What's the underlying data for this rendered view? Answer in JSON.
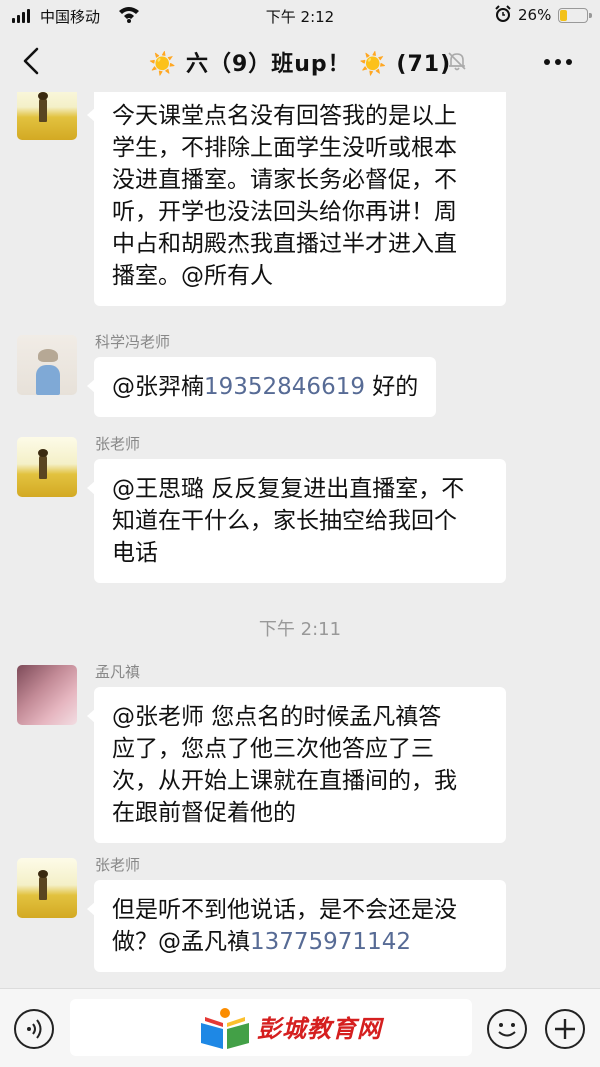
{
  "status_bar": {
    "carrier": "中国移动",
    "time": "下午 2:12",
    "battery": "26%",
    "battery_level": 0.26
  },
  "nav": {
    "title": "六（9）班up！",
    "member_count": "(71)",
    "title_emoji": "☀️"
  },
  "messages": [
    {
      "sender": "",
      "avatar": "field-avatar",
      "text": "今天课堂点名没有回答我的是以上学生，不排除上面学生没听或根本没进直播室。请家长务必督促，不听，开学也没法回头给你再讲！周中占和胡殿杰我直播过半才进入直播室。@所有人",
      "lines": [
        "今天课堂点名没有回答我的是以上",
        "学生，不排除上面学生没听或根本",
        "没进直播室。请家长务必督促，不",
        "听，开学也没法回头给你再讲！周",
        "中占和胡殿杰我直播过半才进入直",
        "播室。@所有人"
      ]
    },
    {
      "sender": "科学冯老师",
      "avatar": "girl-avatar",
      "prefix": "@张羿楠",
      "phone": "19352846619",
      "suffix": " 好的"
    },
    {
      "sender": "张老师",
      "avatar": "field-avatar",
      "lines": [
        "@王思璐 反反复复进出直播室，不",
        "知道在干什么，家长抽空给我回个",
        "电话"
      ]
    },
    {
      "time_divider": "下午 2:11"
    },
    {
      "sender": "孟凡禛",
      "avatar": "pink-avatar",
      "lines": [
        "@张老师 您点名的时候孟凡禛答",
        "应了，您点了他三次他答应了三",
        "次，从开始上课就在直播间的，我",
        "在跟前督促着他的"
      ]
    },
    {
      "sender": "张老师",
      "avatar": "field-avatar",
      "line1": "但是听不到他说话，是不会还是没",
      "line2_prefix": "做？@孟凡禛",
      "phone": "13775971142"
    }
  ],
  "input_bar": {
    "watermark": "彭城教育网"
  },
  "colors": {
    "background": "#ededed",
    "bubble": "#ffffff",
    "phone_link": "#576b95",
    "watermark": "#d51f1f"
  }
}
